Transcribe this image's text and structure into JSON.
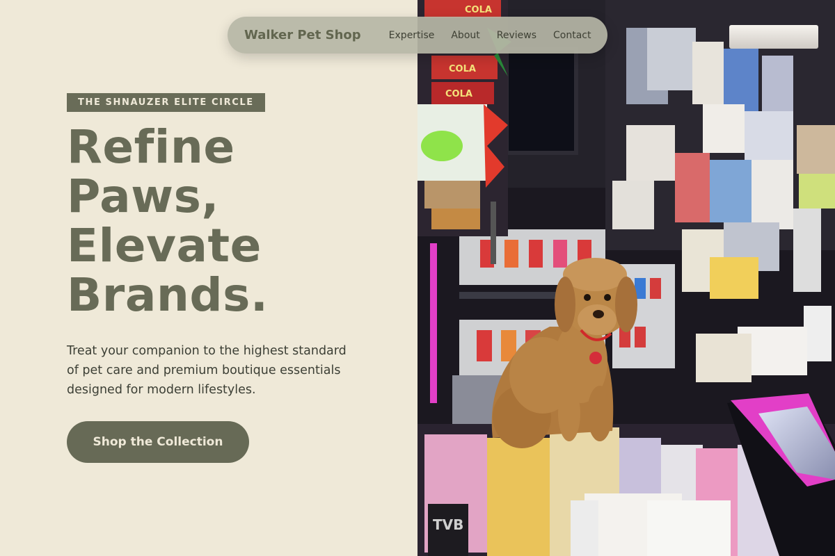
{
  "nav": {
    "brand": "Walker Pet Shop",
    "links": [
      "Expertise",
      "About",
      "Reviews",
      "Contact"
    ]
  },
  "hero": {
    "eyebrow": "THE SHNAUZER ELITE CIRCLE",
    "headline_lines": [
      "Refine",
      "Paws,",
      "Elevate",
      "Brands."
    ],
    "subcopy": "Treat your companion to the highest standard of pet care and premium boutique essentials designed for modern lifestyles.",
    "cta_label": "Shop the Collection"
  },
  "photo": {
    "subject": "poodle sitting on a shop counter with magazines",
    "snack_bag_text": "COLA",
    "counter_sign_text": "TVB"
  },
  "colors": {
    "background": "#efe9d8",
    "accent": "#686b57",
    "nav_pill": "#b6b6a6",
    "text_dark": "#3c3f35",
    "neon_pink": "#e23fc7"
  }
}
